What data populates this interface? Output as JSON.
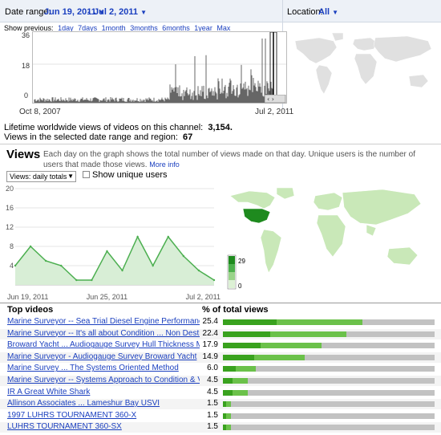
{
  "header": {
    "date_range_label": "Date range:",
    "date_start": "Jun 19, 2011",
    "date_sep": "-",
    "date_end": "Jul 2, 2011",
    "location_label": "Location:",
    "location_value": "All",
    "show_previous_label": "Show previous:",
    "show_previous_options": [
      "1day",
      "7days",
      "1month",
      "3months",
      "6months",
      "1year",
      "Max"
    ]
  },
  "overview_chart": {
    "y_ticks": [
      "36",
      "18",
      "0"
    ],
    "x_start": "Oct 8, 2007",
    "x_end": "Jul 2, 2011"
  },
  "summary": {
    "lifetime_label": "Lifetime worldwide views of videos on this channel:",
    "lifetime_value": "3,154.",
    "selected_label": "Views in the selected date range and region:",
    "selected_value": "67"
  },
  "views": {
    "title": "Views",
    "description": "Each day on the graph shows the total number of views made on that day. Unique users is the number of users that made those views.",
    "more_info": "More info",
    "select_value": "Views: daily totals",
    "unique_label": "Show unique users"
  },
  "chart_data": {
    "type": "area",
    "x": [
      "Jun 19, 2011",
      "Jun 20, 2011",
      "Jun 21, 2011",
      "Jun 22, 2011",
      "Jun 23, 2011",
      "Jun 24, 2011",
      "Jun 25, 2011",
      "Jun 26, 2011",
      "Jun 27, 2011",
      "Jun 28, 2011",
      "Jun 29, 2011",
      "Jun 30, 2011",
      "Jul 1, 2011",
      "Jul 2, 2011"
    ],
    "tick_labels": [
      "Jun 19, 2011",
      "Jun 25, 2011",
      "Jul 2, 2011"
    ],
    "values": [
      4,
      8,
      5,
      4,
      1,
      1,
      7,
      3,
      10,
      4,
      10,
      6,
      3,
      1
    ],
    "y_ticks": [
      0,
      4,
      8,
      12,
      16,
      20
    ],
    "ylim": [
      0,
      20
    ],
    "color": "#4caf50"
  },
  "map_legend": {
    "max": "29",
    "min": "0"
  },
  "top_videos": {
    "header_title": "Top videos",
    "header_pct": "% of total views",
    "rows": [
      {
        "title": "Marine Surveyor -- Sea Trial Diesel Engine Performance",
        "pct": "25.4",
        "value": 25.4
      },
      {
        "title": "Marine Surveyor -- It's all about Condition ... Non Destructive Te",
        "pct": "22.4",
        "value": 22.4
      },
      {
        "title": "Broward Yacht ... Audiogauge Survey Hull Thickness Measurer",
        "pct": "17.9",
        "value": 17.9
      },
      {
        "title": "Marine Surveyor - Audiogauge Survey Broward Yacht",
        "pct": "14.9",
        "value": 14.9
      },
      {
        "title": "Marine Survey ... The Systems Oriented Method",
        "pct": "6.0",
        "value": 6.0
      },
      {
        "title": "Marine Surveyor -- Systems Approach to Condition & Value",
        "pct": "4.5",
        "value": 4.5
      },
      {
        "title": "IR A Great White Shark",
        "pct": "4.5",
        "value": 4.5
      },
      {
        "title": "Allinson Associates ... Lameshur Bay USVI",
        "pct": "1.5",
        "value": 1.5
      },
      {
        "title": "1997 LUHRS TOURNAMENT 360-X",
        "pct": "1.5",
        "value": 1.5
      },
      {
        "title": "LUHRS TOURNAMENT 360-SX",
        "pct": "1.5",
        "value": 1.5
      }
    ]
  }
}
